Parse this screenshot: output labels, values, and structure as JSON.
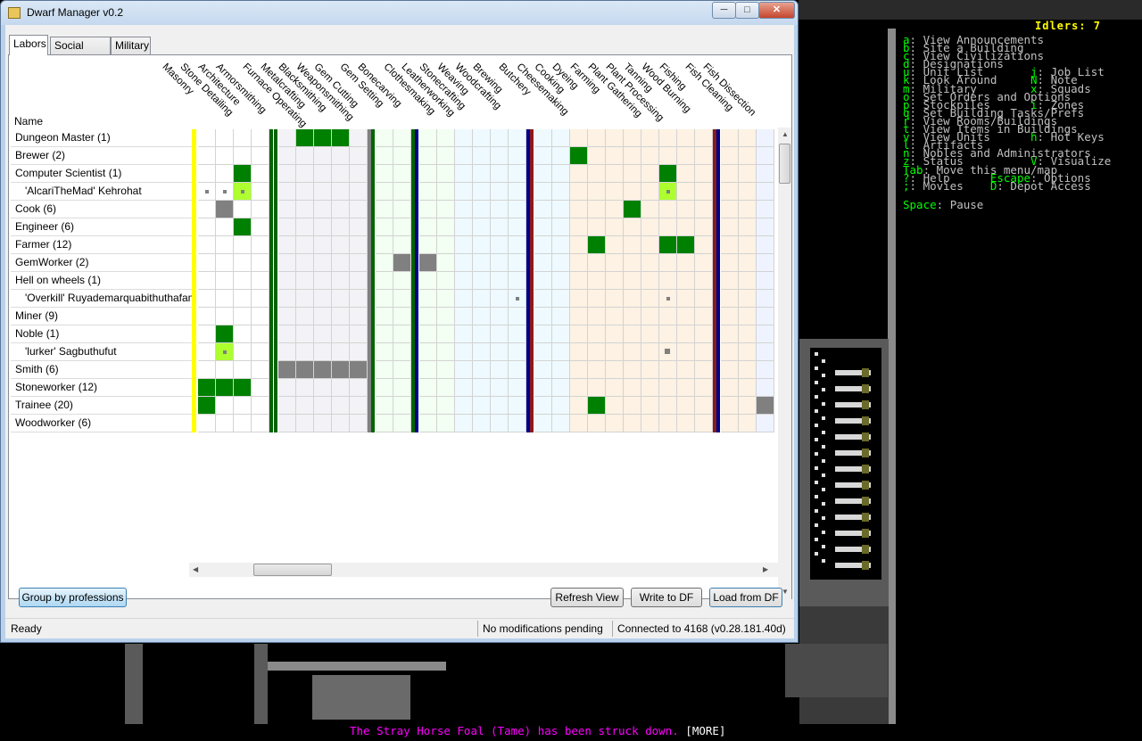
{
  "window": {
    "title": "Dwarf Manager v0.2",
    "min_glyph": "─",
    "max_glyph": "□",
    "close_glyph": "✕"
  },
  "tabs": [
    {
      "label": "Labors",
      "active": true
    },
    {
      "label": "Social Skills",
      "active": false
    },
    {
      "label": "Military",
      "active": false
    }
  ],
  "grid": {
    "name_header": "Name",
    "columns": [
      "Masonry",
      "Stone Detailing",
      "Architecture",
      "Armorsmithing",
      "Furnace Operating",
      "Metalcrafting",
      "Blacksmithing",
      "Weaponsmithing",
      "Gem Cutting",
      "Gem Setting",
      "Bonecarving",
      "Clothesmaking",
      "Leatherworking",
      "Stonecrafting",
      "Weaving",
      "Woodcrafting",
      "Brewing",
      "Butchery",
      "Cheesemaking",
      "Cooking",
      "Dyeing",
      "Farming",
      "Plant Gathering",
      "Plant Processing",
      "Tanning",
      "Wood Burning",
      "Fishing",
      "Fish Cleaning",
      "Fish Dissection"
    ],
    "rows": [
      {
        "name": "Dungeon Master (1)",
        "indent": false
      },
      {
        "name": "Brewer (2)",
        "indent": false
      },
      {
        "name": "Computer Scientist (1)",
        "indent": false
      },
      {
        "name": "'AlcariTheMad' Kehrohat",
        "indent": true
      },
      {
        "name": "Cook (6)",
        "indent": false
      },
      {
        "name": "Engineer (6)",
        "indent": false
      },
      {
        "name": "Farmer (12)",
        "indent": false
      },
      {
        "name": "GemWorker (2)",
        "indent": false
      },
      {
        "name": "Hell on wheels (1)",
        "indent": false
      },
      {
        "name": "'Overkill' Ruyademarquabithuthafam",
        "indent": true
      },
      {
        "name": "Miner (9)",
        "indent": false
      },
      {
        "name": "Noble (1)",
        "indent": false
      },
      {
        "name": "'lurker' Sagbuthufut",
        "indent": true
      },
      {
        "name": "Smith (6)",
        "indent": false
      },
      {
        "name": "Stoneworker (12)",
        "indent": false
      },
      {
        "name": "Trainee (20)",
        "indent": false
      },
      {
        "name": "Woodworker (6)",
        "indent": false
      }
    ],
    "cell_states": {
      "0": {
        "5": "g",
        "6": "g",
        "7": "g"
      },
      "1": {
        "19": "g"
      },
      "2": {
        "2": "g",
        "24": "g"
      },
      "3": {
        "0": "dot",
        "1": "dot",
        "2": "lgdot",
        "24": "lgdot"
      },
      "4": {
        "1": "gr",
        "22": "g"
      },
      "5": {
        "2": "g"
      },
      "6": {
        "20": "g",
        "24": "g",
        "25": "g"
      },
      "7": {
        "10": "gr",
        "11": "gr"
      },
      "9": {
        "16": "dot",
        "24": "dot"
      },
      "11": {
        "1": "g"
      },
      "12": {
        "1": "lgdot",
        "24": "gdot"
      },
      "13": {
        "4": "gr",
        "5": "gr",
        "6": "gr",
        "7": "gr",
        "8": "gr"
      },
      "14": {
        "0": "g",
        "1": "g",
        "2": "g"
      },
      "15": {
        "0": "g",
        "20": "g",
        "29": "gr"
      }
    },
    "colors": {
      "green": "#008000",
      "light_green": "#adff2f",
      "gray": "#808080",
      "stone_tint": "#ffffff",
      "metal_tint": "#f3f3f7",
      "craft_tint": "#f2fff2",
      "cloth_tint": "#eefaff",
      "food_tint": "#fdf2e3",
      "fish_tint": "#eef3ff",
      "yellow": "#ffff00",
      "dark_green": "#006400",
      "dark_blue": "#00008b",
      "dark_red": "#8b1a1a"
    }
  },
  "buttons": {
    "group": "Group by professions",
    "refresh": "Refresh View",
    "write": "Write to DF",
    "load": "Load from DF"
  },
  "status": {
    "ready": "Ready",
    "pending": "No modifications pending",
    "connected": "Connected to 4168 (v0.28.181.40d)"
  },
  "df": {
    "idlers": "Idlers: 7",
    "menu": [
      [
        "a",
        ": View Announcements"
      ],
      [
        "b",
        ": Site a Building"
      ],
      [
        "c",
        ": View Civilizations"
      ],
      [
        "d",
        ": Designations"
      ],
      [
        "u",
        ": Unit List       ",
        "j",
        ": Job List"
      ],
      [
        "k",
        ": Look Around     ",
        "N",
        ": Note"
      ],
      [
        "m",
        ": Military        ",
        "x",
        ": Squads"
      ],
      [
        "o",
        ": Set Orders and Options"
      ],
      [
        "p",
        ": Stockpiles      ",
        "i",
        ": Zones"
      ],
      [
        "q",
        ": Set Building Tasks/Prefs"
      ],
      [
        "r",
        ": View Rooms/Buildings"
      ],
      [
        "t",
        ": View Items in Buildings"
      ],
      [
        "v",
        ": View Units      ",
        "h",
        ": Hot Keys"
      ],
      [
        "l",
        ": Artifacts"
      ],
      [
        "n",
        ": Nobles and Administrators"
      ],
      [
        "z",
        ": Status          ",
        "V",
        ": Visualize"
      ],
      [
        "Tab",
        ": Move this menu/map"
      ],
      [
        "?",
        ": Help      ",
        "Escape",
        ": Options"
      ],
      [
        ";",
        ": Movies    ",
        "D",
        ": Depot Access"
      ]
    ],
    "space_key": "Space",
    "space_label": ": Pause",
    "message": "The Stray Horse Foal (Tame) has been struck down.",
    "more": "[MORE]"
  }
}
